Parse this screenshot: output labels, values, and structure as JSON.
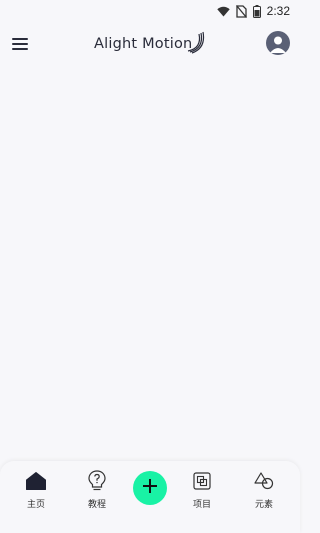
{
  "status_bar": {
    "time": "2:32",
    "icons": [
      "wifi-icon",
      "no-sim-icon",
      "battery-icon"
    ]
  },
  "header": {
    "logo_text": "Alight Motion",
    "menu_icon": "hamburger-menu-icon",
    "avatar_icon": "user-avatar-icon"
  },
  "bottom_nav": {
    "items": [
      {
        "label": "主页",
        "icon": "home-icon",
        "active": true
      },
      {
        "label": "教程",
        "icon": "lightbulb-question-icon",
        "active": false
      },
      {
        "label": "项目",
        "icon": "projects-icon",
        "active": false
      },
      {
        "label": "元素",
        "icon": "elements-icon",
        "active": false
      }
    ],
    "fab_icon": "plus-icon"
  },
  "colors": {
    "background": "#f7f7fa",
    "accent": "#19f2a5",
    "text_dark": "#2a2c3a",
    "avatar": "#5a6075"
  }
}
